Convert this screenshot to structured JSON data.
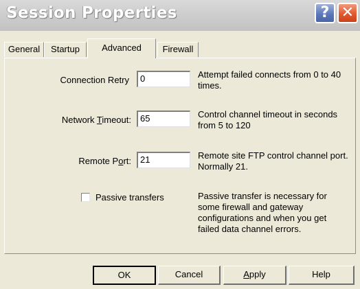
{
  "window": {
    "title": "Session Properties",
    "help_button": "?",
    "close_button": "✕"
  },
  "tabs": [
    {
      "label": "General",
      "active": false
    },
    {
      "label": "Startup",
      "active": false
    },
    {
      "label": "Advanced",
      "active": true
    },
    {
      "label": "Firewall",
      "active": false
    }
  ],
  "form": {
    "connection_retry": {
      "label": "Connection Retry",
      "value": "0",
      "help": "Attempt failed connects from 0 to 40 times."
    },
    "network_timeout": {
      "label_pre": "Network ",
      "label_mnemonic": "T",
      "label_post": "imeout:",
      "value": "65",
      "help": "Control channel timeout in seconds from 5 to 120"
    },
    "remote_port": {
      "label_pre": "Remote P",
      "label_mnemonic": "o",
      "label_post": "rt:",
      "value": "21",
      "help": "Remote site FTP control channel port. Normally 21."
    },
    "passive_transfers": {
      "label": "Passive transfers",
      "checked": false,
      "help": "Passive transfer is necessary for some firewall and gateway configurations and when you get failed data channel errors."
    }
  },
  "buttons": {
    "ok": "OK",
    "cancel": "Cancel",
    "apply_mnemonic": "A",
    "apply_rest": "pply",
    "help": "Help"
  }
}
